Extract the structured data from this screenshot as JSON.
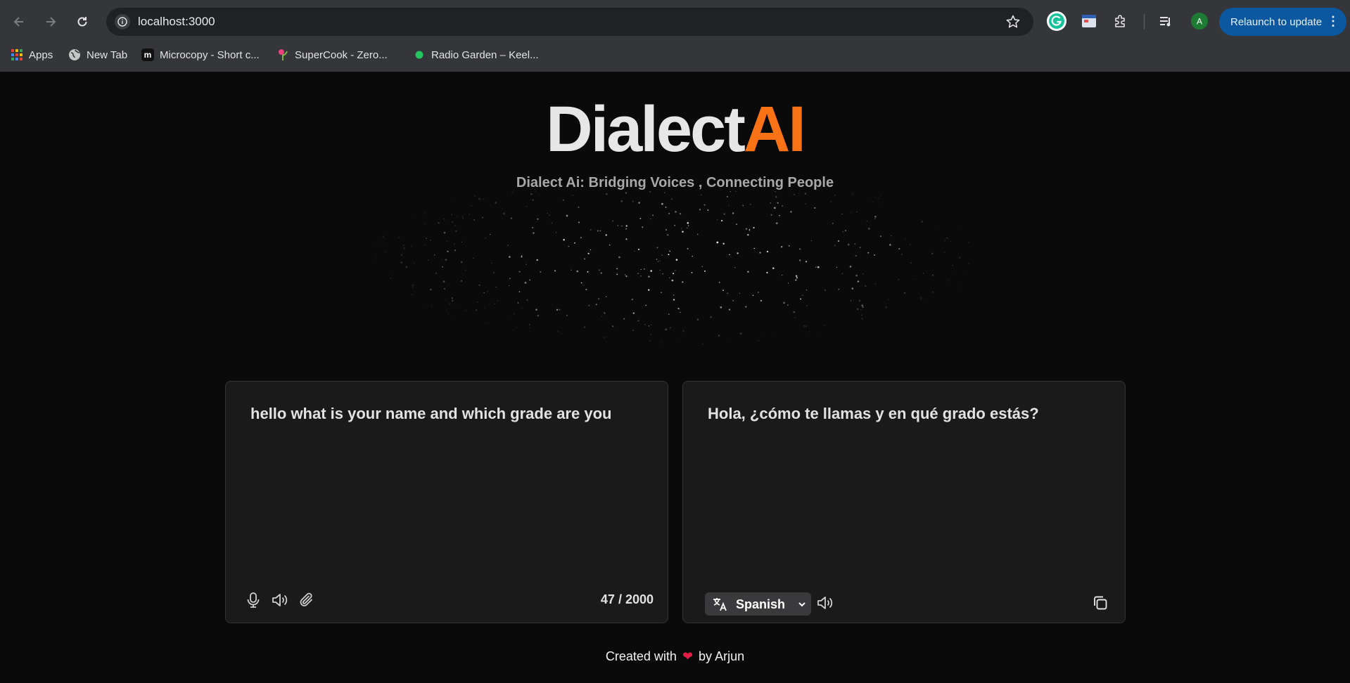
{
  "browser": {
    "url": "localhost:3000",
    "relaunch_label": "Relaunch to update",
    "profile_initial": "A",
    "bookmarks": [
      {
        "label": "Apps",
        "icon": "apps-grid-icon"
      },
      {
        "label": "New Tab",
        "icon": "globe-icon"
      },
      {
        "label": "Microcopy - Short c...",
        "icon": "microcopy-icon"
      },
      {
        "label": "SuperCook - Zero...",
        "icon": "supercook-icon"
      },
      {
        "label": "Radio Garden – Keel...",
        "icon": "radio-garden-icon"
      }
    ]
  },
  "header": {
    "brand_main": "Dialect",
    "brand_accent": "AI",
    "tagline": "Dialect Ai: Bridging Voices , Connecting People",
    "accent_color": "#f97316"
  },
  "source_panel": {
    "text": "hello what is your name and which grade are you",
    "counter": "47 / 2000",
    "tools": [
      "microphone-icon",
      "speaker-icon",
      "paperclip-icon"
    ]
  },
  "target_panel": {
    "text": "Hola, ¿cómo te llamas y en qué grado estás?",
    "language": "Spanish",
    "tools": [
      "translate-icon",
      "speaker-icon",
      "copy-icon"
    ]
  },
  "footer": {
    "prefix": "Created with",
    "suffix": "by Arjun",
    "heart": "❤"
  }
}
